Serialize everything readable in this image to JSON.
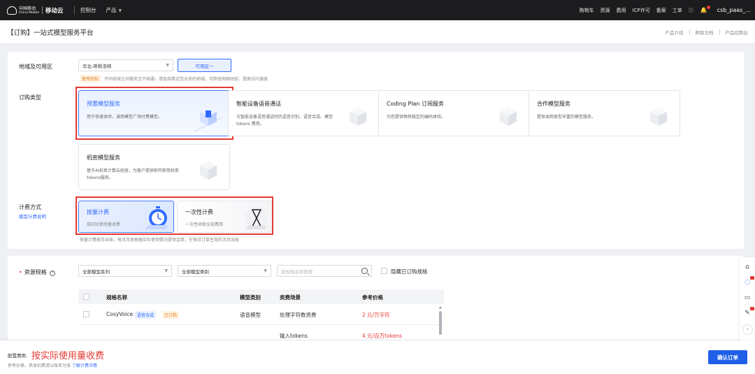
{
  "nav": {
    "brand_cn": "中国移动",
    "brand_en": "China Mobile",
    "brand_cloud": "移动云",
    "links": [
      "控制台",
      "产品"
    ],
    "right": [
      "购物车",
      "资源",
      "费用",
      "ICP许可",
      "备案",
      "工单"
    ],
    "help_icon": "question-circle-icon",
    "bell_icon": "bell-icon",
    "user": "csb_paas_..."
  },
  "titlebar": {
    "title": "【订购】一站式模型服务平台",
    "links": [
      "产品介绍",
      "帮助文档",
      "产品控制台"
    ]
  },
  "region": {
    "label": "地域及可用区",
    "region_value": "华北-呼和浩特",
    "zone_label": "可用区一",
    "notice_tag": "使用须知",
    "notice_text": "不同地域之间服务互不相通，请选择靠近您业务的地域，可降低网络时延、提高访问速度"
  },
  "order_type": {
    "label": "订购类型",
    "cards": [
      {
        "name": "预置模型服务",
        "desc": "用于快速体验，调用模型广场付费模型。",
        "selected": true
      },
      {
        "name": "智能设备语音通话",
        "desc": "与智能设备语音通话时的语音识别、语音合成、模型 tokens 费用。",
        "selected": false
      },
      {
        "name": "Coding Plan 订阅服务",
        "desc": "为您提供畅快稳定的编码体验。",
        "selected": false
      },
      {
        "name": "合作模型服务",
        "desc": "提供调用类型丰富的模型服务。",
        "selected": false
      },
      {
        "name": "机密模型服务",
        "desc": "基于AI机密计算云底座，为客户提供即开即用机密tokens服务。",
        "selected": false
      }
    ]
  },
  "billing": {
    "label": "计费方式",
    "sublink": "模型计费说明",
    "options": [
      {
        "name": "按量计费",
        "desc": "按实际使用量收费",
        "selected": true
      },
      {
        "name": "一次性计费",
        "desc": "一次性收取全部费用",
        "selected": false
      }
    ],
    "note": "按量计费按月出账，每月月底根据实际使用情况提供话单，在每月订单生效的次月出账"
  },
  "resource": {
    "label": "资源规格",
    "filter_series": "全部模型系列",
    "filter_category": "全部模型类别",
    "search_placeholder": "按规格名称搜索",
    "hide_ordered_label": "隐藏已订购规格",
    "columns": [
      "规格名称",
      "模型类别",
      "资费场景",
      "参考价格"
    ],
    "rows": [
      {
        "name": "CosyVoice",
        "badge": "语音合成",
        "ordered": "已订购",
        "category": "语音模型",
        "scene": "处理字符数资费",
        "price": "2 元/万字符"
      },
      {
        "name": "",
        "badge": "",
        "ordered": "",
        "category": "",
        "scene": "输入tokens",
        "price": "4 元/百万tokens"
      }
    ]
  },
  "footer": {
    "fee_label": "配置费用:",
    "fee_value": "按实际使用量收费",
    "fee_note": "参考价格，具体扣费请以账单为准",
    "fee_link": "了解计费详情",
    "confirm": "确认订单"
  },
  "tools": {
    "icons": [
      "home-icon",
      "headset-icon",
      "book-icon",
      "edit-icon"
    ],
    "more_icon": "chevron-right-icon"
  },
  "colors": {
    "primary": "#2f6bff",
    "highlight": "#e53935",
    "price": "#e53935",
    "nav_bg": "#1c1c1e"
  }
}
